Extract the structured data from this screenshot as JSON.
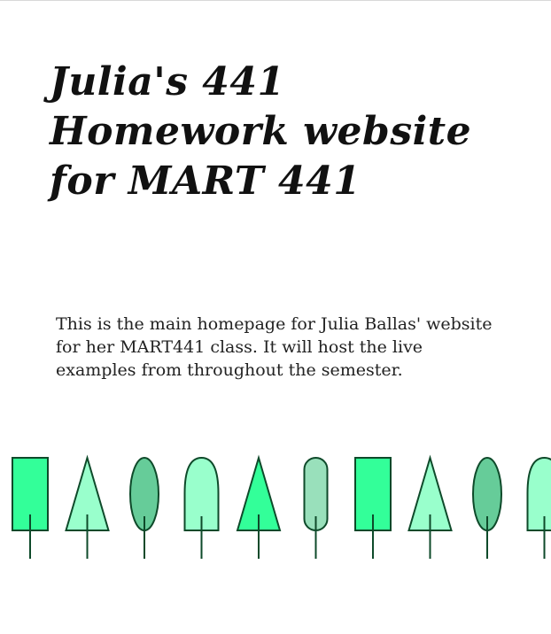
{
  "header": {
    "title": "Julia's 441 Homework website for MART 441"
  },
  "main": {
    "intro": "This is the main homepage for Julia Ballas' website for her MART441 class. It will host the live examples from throughout the semester."
  },
  "tree_row": {
    "trees": [
      {
        "shape": "rectangle",
        "color": "#33ff99"
      },
      {
        "shape": "triangle",
        "color": "#99ffcc"
      },
      {
        "shape": "ellipse",
        "color": "#66cc99"
      },
      {
        "shape": "arch",
        "color": "#99ffcc"
      },
      {
        "shape": "triangle",
        "color": "#33ff99"
      },
      {
        "shape": "capsule",
        "color": "#99e0bb"
      },
      {
        "shape": "rectangle",
        "color": "#33ff99"
      },
      {
        "shape": "triangle",
        "color": "#99ffcc"
      },
      {
        "shape": "ellipse",
        "color": "#66cc99"
      },
      {
        "shape": "arch",
        "color": "#99ffcc"
      }
    ],
    "outline_color": "#0e4a2a"
  }
}
